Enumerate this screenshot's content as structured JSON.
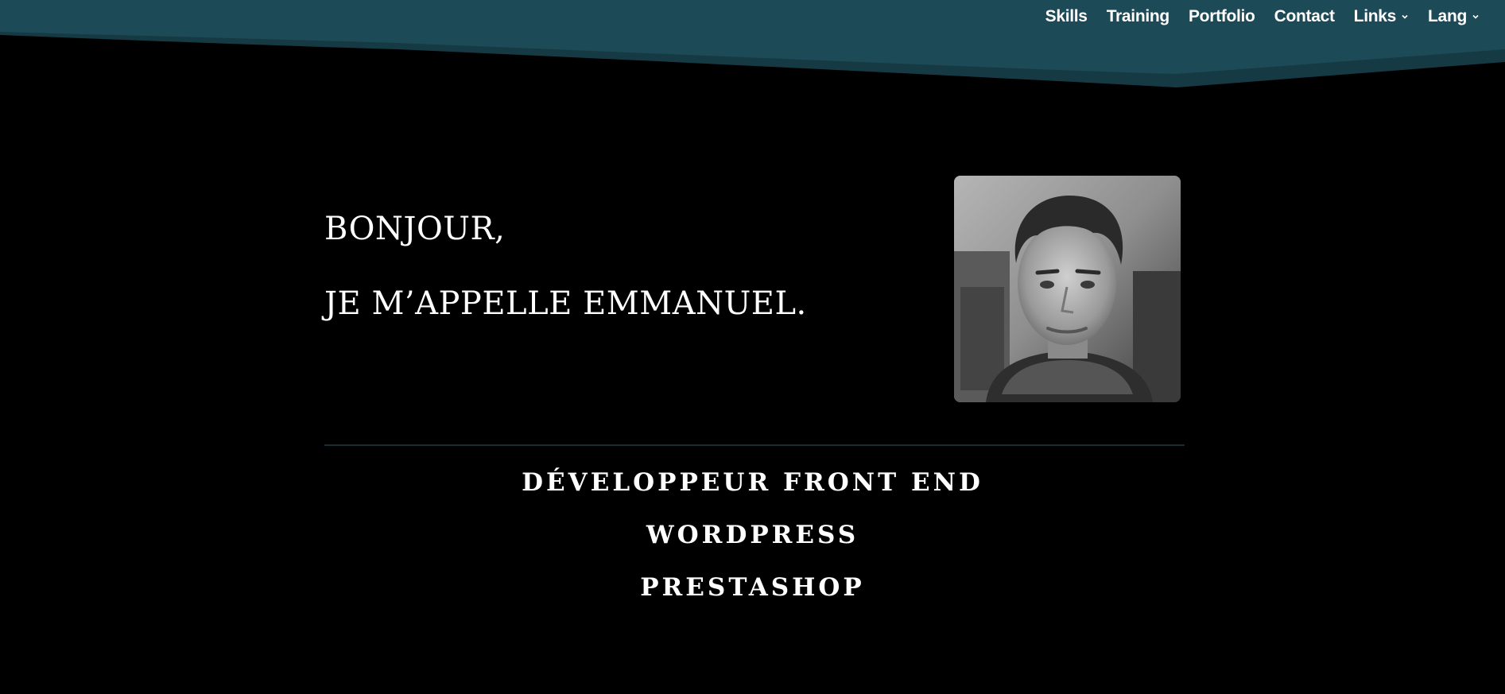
{
  "nav": {
    "items": [
      {
        "label": "Skills"
      },
      {
        "label": "Training"
      },
      {
        "label": "Portfolio"
      },
      {
        "label": "Contact"
      },
      {
        "label": "Links",
        "has_dropdown": true,
        "icon": "chevron-down-icon"
      },
      {
        "label": "Lang",
        "has_dropdown": true,
        "icon": "chevron-down-icon"
      }
    ]
  },
  "hero": {
    "line1": "BONJOUR,",
    "line2": "JE M’APPELLE EMMANUEL.",
    "portrait": "portrait-photo"
  },
  "roles": [
    "DÉVELOPPEUR FRONT END",
    "WORDPRESS",
    "PRESTASHOP"
  ],
  "colors": {
    "header": "#1d4a57",
    "header_shadow": "#163a44",
    "background": "#000000",
    "text": "#ffffff",
    "divider": "#1c2b31"
  }
}
